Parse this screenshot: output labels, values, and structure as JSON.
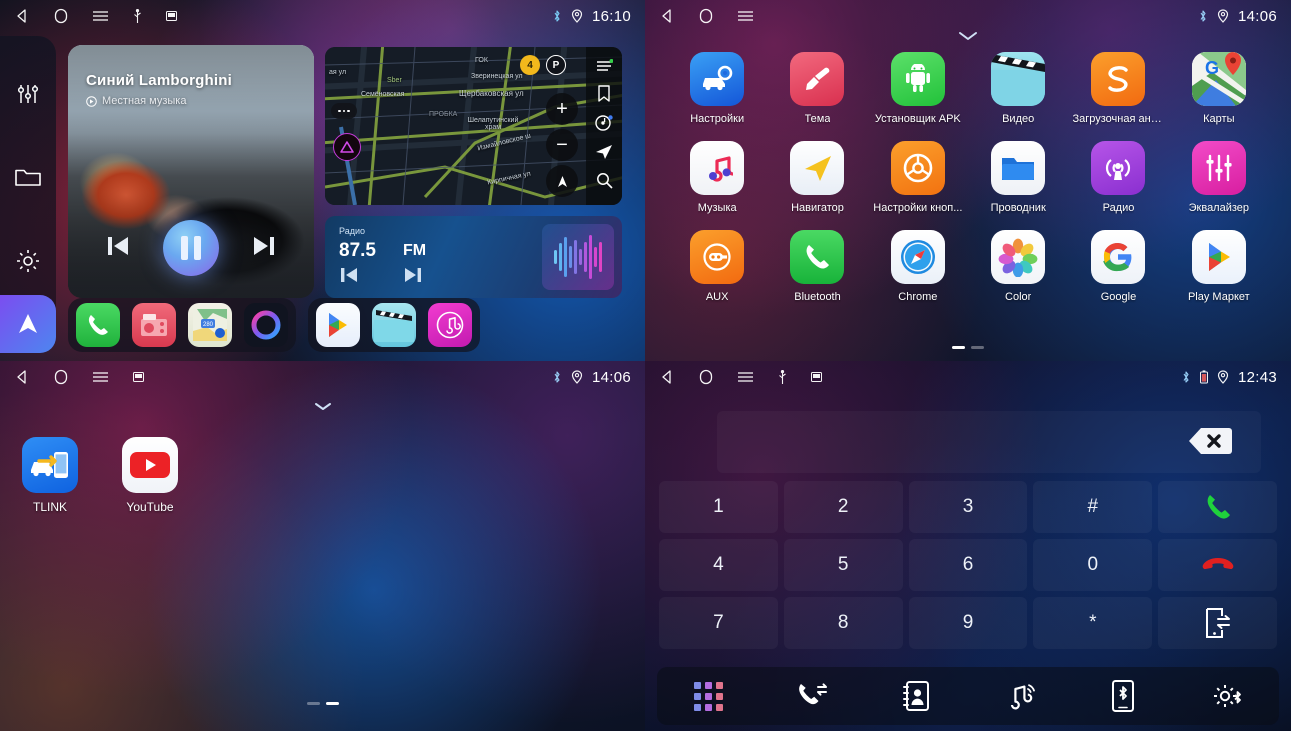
{
  "panels": {
    "home": {
      "status": {
        "time": "16:10",
        "icons": [
          "back-icon",
          "home-icon",
          "menu-icon",
          "usb-icon",
          "sdcard-icon",
          "bluetooth-icon",
          "location-icon"
        ]
      },
      "sidebar": [
        {
          "name": "equalizer-icon",
          "label": "Equalizer"
        },
        {
          "name": "folder-icon",
          "label": "Files"
        },
        {
          "name": "gear-icon",
          "label": "Settings"
        }
      ],
      "nav_button": {
        "name": "navigation-arrow-icon",
        "label": "Navigation"
      },
      "music": {
        "title": "Синий Lamborghini",
        "subtitle": "Местная музыка",
        "state": "playing",
        "prev_label": "Previous",
        "play_label": "Pause",
        "next_label": "Next"
      },
      "map": {
        "traffic_badge": "4",
        "parking_badge": "P",
        "labels": [
          "ая ул",
          "Sber",
          "ГОК",
          "Зверинецкая ул",
          "Щербаковская ул",
          "Семёновская",
          "ПРОБКА",
          "Шелапутинский храм",
          "Измайловское ш",
          "Кирпичная ул"
        ],
        "zoom_in": "+",
        "zoom_out": "−",
        "rail_icons": [
          "menu-icon",
          "bookmark-icon",
          "music-disc-icon",
          "navigate-icon",
          "search-icon"
        ]
      },
      "radio": {
        "label": "Радио",
        "frequency": "87.5",
        "band": "FM",
        "prev_label": "Previous station",
        "next_label": "Next station"
      },
      "dock": [
        {
          "name": "phone-app-icon",
          "label": "Phone"
        },
        {
          "name": "radio-app-icon",
          "label": "Radio"
        },
        {
          "name": "maps-app-icon",
          "label": "Maps"
        },
        {
          "name": "siri-app-icon",
          "label": "Assistant"
        },
        {
          "name": "play-store-app-icon",
          "label": "Play Store"
        },
        {
          "name": "video-app-icon",
          "label": "Video"
        },
        {
          "name": "music-app-icon",
          "label": "Music"
        }
      ]
    },
    "drawer": {
      "status": {
        "time": "14:06"
      },
      "handle": "chevron-down-icon",
      "apps": [
        {
          "label": "Настройки",
          "icon": "settings-car-icon"
        },
        {
          "label": "Тема",
          "icon": "theme-brush-icon"
        },
        {
          "label": "Установщик APK",
          "icon": "apk-installer-icon"
        },
        {
          "label": "Видео",
          "icon": "video-clapper-icon"
        },
        {
          "label": "Загрузочная ани...",
          "icon": "boot-animation-icon"
        },
        {
          "label": "Карты",
          "icon": "google-maps-icon"
        },
        {
          "label": "Музыка",
          "icon": "music-note-icon"
        },
        {
          "label": "Навигатор",
          "icon": "navigator-arrow-icon"
        },
        {
          "label": "Настройки кноп...",
          "icon": "steering-wheel-icon"
        },
        {
          "label": "Проводник",
          "icon": "file-folder-icon"
        },
        {
          "label": "Радио",
          "icon": "radio-broadcast-icon"
        },
        {
          "label": "Эквалайзер",
          "icon": "equalizer-sliders-icon"
        },
        {
          "label": "AUX",
          "icon": "aux-plug-icon"
        },
        {
          "label": "Bluetooth",
          "icon": "phone-handset-icon"
        },
        {
          "label": "Chrome",
          "icon": "safari-compass-icon"
        },
        {
          "label": "Color",
          "icon": "color-flower-icon"
        },
        {
          "label": "Google",
          "icon": "google-g-icon"
        },
        {
          "label": "Play Маркет",
          "icon": "play-store-icon"
        }
      ],
      "pages": {
        "count": 2,
        "active": 1
      }
    },
    "home2": {
      "status": {
        "time": "14:06"
      },
      "handle": "chevron-down-icon",
      "apps": [
        {
          "label": "TLINK",
          "icon": "tlink-icon"
        },
        {
          "label": "YouTube",
          "icon": "youtube-icon"
        }
      ],
      "pages": {
        "count": 2,
        "active": 2
      }
    },
    "dialer": {
      "status": {
        "time": "12:43"
      },
      "input_value": "",
      "input_placeholder": "",
      "backspace_label": "Backspace",
      "keys": [
        {
          "label": "1",
          "name": "key-1"
        },
        {
          "label": "2",
          "name": "key-2"
        },
        {
          "label": "3",
          "name": "key-3"
        },
        {
          "label": "#",
          "name": "key-hash"
        },
        {
          "label": "",
          "name": "call-button"
        },
        {
          "label": "4",
          "name": "key-4"
        },
        {
          "label": "5",
          "name": "key-5"
        },
        {
          "label": "6",
          "name": "key-6"
        },
        {
          "label": "0",
          "name": "key-0"
        },
        {
          "label": "",
          "name": "hangup-button"
        },
        {
          "label": "7",
          "name": "key-7"
        },
        {
          "label": "8",
          "name": "key-8"
        },
        {
          "label": "9",
          "name": "key-9"
        },
        {
          "label": "*",
          "name": "key-star"
        },
        {
          "label": "",
          "name": "transfer-audio-button"
        }
      ],
      "toolbar": [
        {
          "name": "dialpad-icon",
          "label": "Dialpad"
        },
        {
          "name": "call-log-icon",
          "label": "Call log"
        },
        {
          "name": "contacts-icon",
          "label": "Contacts"
        },
        {
          "name": "bluetooth-music-icon",
          "label": "Bluetooth music"
        },
        {
          "name": "bluetooth-device-icon",
          "label": "Paired device"
        },
        {
          "name": "bluetooth-settings-icon",
          "label": "Bluetooth settings"
        }
      ]
    }
  },
  "colors": {
    "accent_blue": "#2a7ff0",
    "green": "#1fcc4d",
    "red": "#e03030",
    "orange": "#f58220",
    "purple": "#8a3fd0",
    "pink": "#e4197f"
  }
}
